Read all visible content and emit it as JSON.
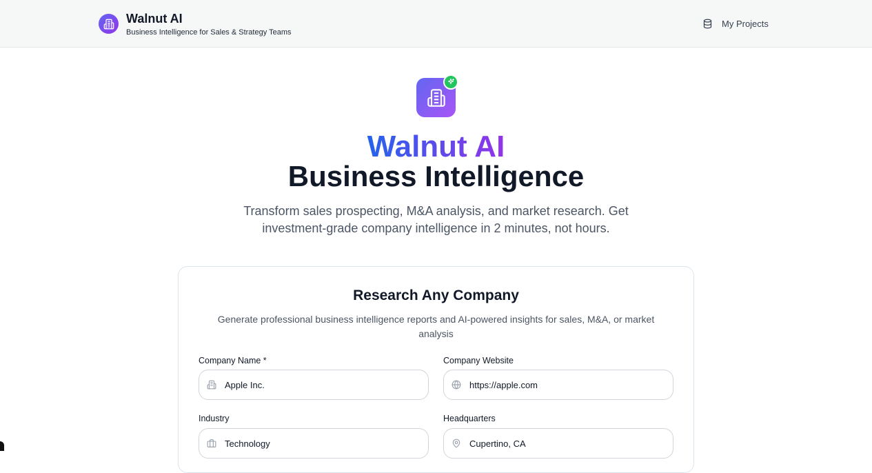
{
  "header": {
    "app_name": "Walnut AI",
    "tagline": "Business Intelligence for Sales & Strategy Teams",
    "nav_projects": "My Projects"
  },
  "hero": {
    "title_line1": "Walnut AI",
    "title_line2": "Business Intelligence",
    "description": "Transform sales prospecting, M&A analysis, and market research. Get investment-grade company intelligence in 2 minutes, not hours."
  },
  "form": {
    "title": "Research Any Company",
    "description": "Generate professional business intelligence reports and AI-powered insights for sales, M&A, or market analysis",
    "company_name": {
      "label": "Company Name *",
      "value": "Apple Inc."
    },
    "company_website": {
      "label": "Company Website",
      "value": "https://apple.com"
    },
    "industry": {
      "label": "Industry",
      "value": "Technology"
    },
    "headquarters": {
      "label": "Headquarters",
      "value": "Cupertino, CA"
    }
  },
  "colors": {
    "brand_gradient_start": "#6366f1",
    "brand_gradient_end": "#9333ea",
    "badge_green": "#22c55e"
  },
  "icons": {
    "brand": "building-icon",
    "projects": "database-icon",
    "hero": "building-icon",
    "hero_badge": "sparkle-icon",
    "company_name": "building-icon",
    "website": "globe-icon",
    "industry": "briefcase-icon",
    "headquarters": "map-pin-icon"
  }
}
